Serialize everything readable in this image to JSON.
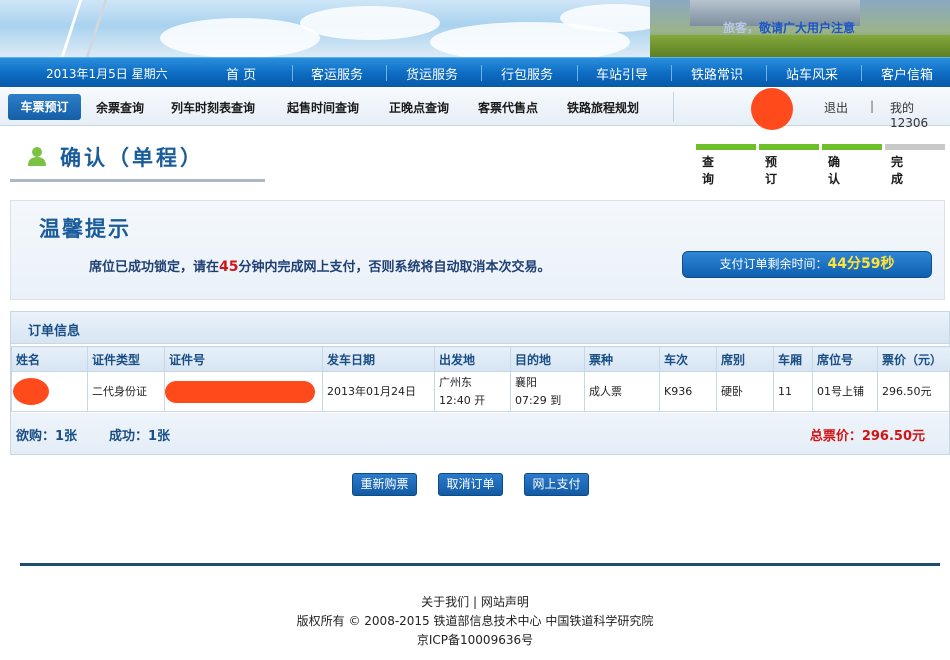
{
  "banner": {
    "notice_prefix": "旅客，",
    "notice_text": "敬请广大用户注意"
  },
  "mainnav": {
    "date": "2013年1月5日 星期六",
    "items": [
      "首 页",
      "客运服务",
      "货运服务",
      "行包服务",
      "车站引导",
      "铁路常识",
      "站车风采",
      "客户信箱"
    ]
  },
  "subnav": {
    "active": "车票预订",
    "items": [
      "余票查询",
      "列车时刻表查询",
      "起售时间查询",
      "正晚点查询",
      "客票代售点",
      "铁路旅程规划"
    ],
    "logout": "退出",
    "divider": "|",
    "my": "我的12306"
  },
  "page": {
    "title": "确认（单程）"
  },
  "steps": [
    {
      "label": "查询",
      "color": "#6fbf2a"
    },
    {
      "label": "预订",
      "color": "#6fbf2a"
    },
    {
      "label": "确认",
      "color": "#6fbf2a"
    },
    {
      "label": "完成",
      "color": "#c9c9c9"
    }
  ],
  "tip": {
    "heading": "温馨提示",
    "msg_before": "席位已成功锁定，请在",
    "minutes": "45",
    "msg_after": "分钟内完成网上支付，否则系统将自动取消本次交易。",
    "timer_label": "支付订单剩余时间：",
    "timer_value": "44分59秒"
  },
  "order": {
    "heading": "订单信息",
    "columns": [
      "姓名",
      "证件类型",
      "证件号",
      "发车日期",
      "出发地",
      "目的地",
      "票种",
      "车次",
      "席别",
      "车厢",
      "席位号",
      "票价（元）"
    ],
    "row": {
      "name": "",
      "id_type": "二代身份证",
      "id_no": "",
      "date": "2013年01月24日",
      "from": "广州东",
      "from_time": "12:40 开",
      "to": "襄阳",
      "to_time": "07:29 到",
      "ticket_type": "成人票",
      "train": "K936",
      "seat_class": "硬卧",
      "car": "11",
      "seat": "01号上铺",
      "price": "296.50元"
    },
    "want": "欲购：1张",
    "success": "成功：1张",
    "total": "总票价：296.50元"
  },
  "buttons": {
    "rebuy": "重新购票",
    "cancel": "取消订单",
    "pay": "网上支付"
  },
  "footer": {
    "links": "关于我们 | 网站声明",
    "copyright": "版权所有 © 2008-2015 铁道部信息技术中心 中国铁道科学研究院",
    "icp": "京ICP备10009636号"
  }
}
